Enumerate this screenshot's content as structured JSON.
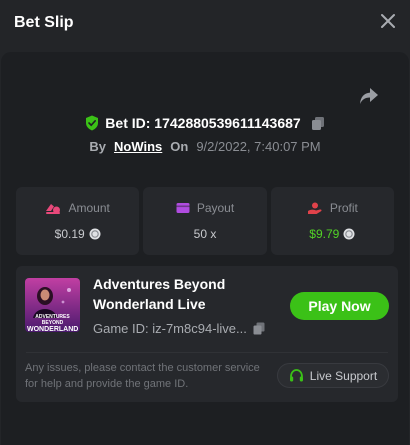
{
  "header": {
    "title": "Bet Slip",
    "close_icon": "close-icon"
  },
  "bet": {
    "id_label": "Bet ID: 1742880539611143687",
    "by_label": "By",
    "user": "NoWins",
    "on_label": "On",
    "date": "9/2/2022, 7:40:07 PM"
  },
  "stats": [
    {
      "label": "Amount",
      "value": "$0.19",
      "icon": "bet-chip-icon",
      "color": "#e8487a"
    },
    {
      "label": "Payout",
      "value": "50 x",
      "icon": "wallet-icon",
      "color": "#b04ce0"
    },
    {
      "label": "Profit",
      "value": "$9.79",
      "icon": "profit-hand-icon",
      "color": "#e0424a"
    }
  ],
  "game": {
    "title": "Adventures Beyond Wonderland Live",
    "id_label": "Game ID: iz-7m8c94-live...",
    "thumb_text": "ADVENTURES BEYOND WONDERLAND LIVE",
    "play_label": "Play Now"
  },
  "support": {
    "message": "Any issues, please contact the customer service for help and provide the game ID.",
    "button_label": "Live Support"
  },
  "colors": {
    "accent_green": "#3bc117",
    "profit_green": "#52d326",
    "panel": "#1d1f22",
    "card": "#26282c"
  }
}
